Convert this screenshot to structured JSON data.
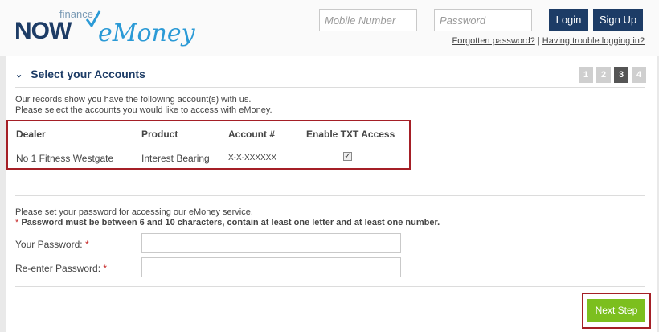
{
  "header": {
    "logo_finance": "finance",
    "logo_now": "NOW",
    "logo_emoney": "eMoney",
    "mobile_placeholder": "Mobile Number",
    "password_placeholder": "Password",
    "login_label": "Login",
    "signup_label": "Sign Up",
    "forgot_link": "Forgotten password?",
    "separator": "|",
    "trouble_link": "Having trouble logging in?"
  },
  "section": {
    "title": "Select your Accounts",
    "steps": [
      "1",
      "2",
      "3",
      "4"
    ],
    "active_step": "3",
    "intro_line1": "Our records show you have the following account(s) with us.",
    "intro_line2": "Please select the accounts you would like to access with eMoney."
  },
  "accounts_table": {
    "headers": [
      "Dealer",
      "Product",
      "Account #",
      "Enable TXT Access"
    ],
    "rows": [
      {
        "dealer": "No 1 Fitness Westgate",
        "product": "Interest Bearing",
        "account": "X-X-XXXXXX",
        "txt_access": true
      }
    ]
  },
  "password_section": {
    "intro": "Please set your password for accessing our eMoney service.",
    "rule_star": "*",
    "rule": "Password must be between 6 and 10 characters, contain at least one letter and at least one number.",
    "your_password_label": "Your Password:",
    "reenter_label": "Re-enter Password:",
    "required_star": "*"
  },
  "footer": {
    "next_label": "Next Step"
  },
  "colors": {
    "brand_navy": "#1d3c66",
    "highlight_red": "#a51f26",
    "next_green": "#7cbf1e"
  }
}
